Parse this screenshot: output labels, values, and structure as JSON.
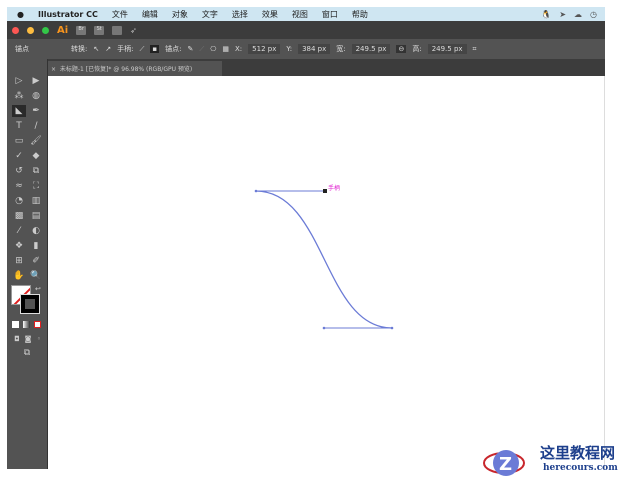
{
  "menubar": {
    "apple": "",
    "app": "Illustrator CC",
    "items": [
      "文件",
      "编辑",
      "对象",
      "文字",
      "选择",
      "效果",
      "视图",
      "窗口",
      "帮助"
    ]
  },
  "titlebar": {
    "app_logo": "Ai",
    "buttons": [
      "Br",
      "St"
    ]
  },
  "control": {
    "label": "锚点",
    "convert": "转换:",
    "handles": "手柄:",
    "anchors": "锚点:",
    "x_label": "X:",
    "x": "512 px",
    "y_label": "Y:",
    "y": "384 px",
    "w_label": "宽:",
    "w": "249.5 px",
    "h_label": "高:",
    "h": "249.5 px"
  },
  "tab": {
    "close": "×",
    "title": "未标题-1 [已恢复]* @ 96.98% (RGB/GPU 预览)"
  },
  "canvas": {
    "handle_label": "手柄",
    "path_color": "#6b7bd6",
    "label_color": "#e020d0"
  },
  "watermark": {
    "title": "这里教程网",
    "url": "herecours.com"
  }
}
